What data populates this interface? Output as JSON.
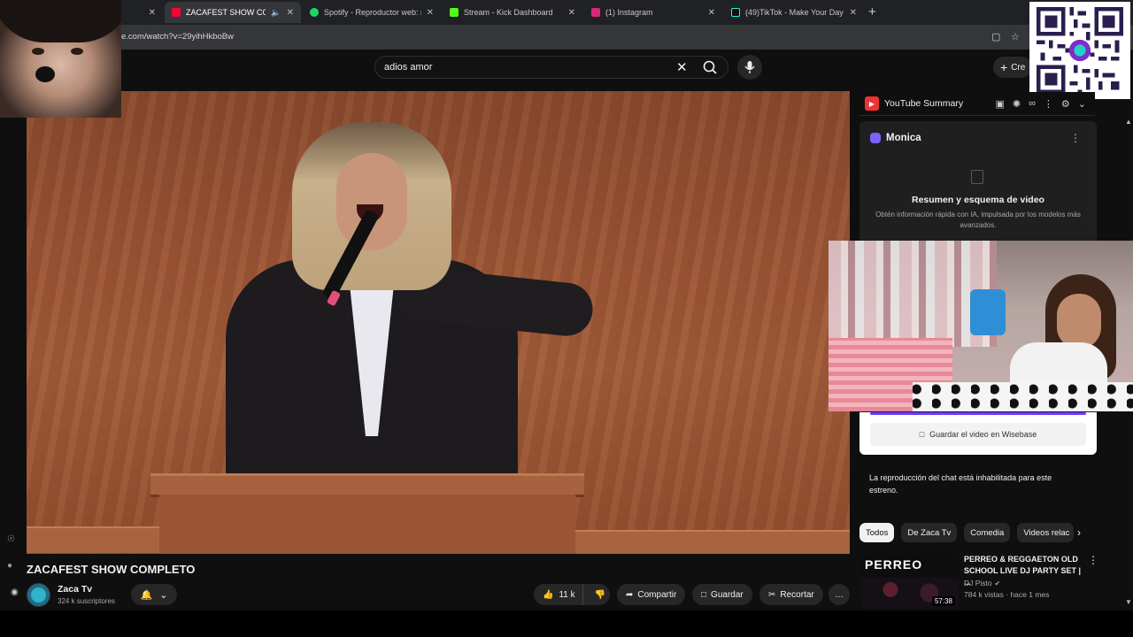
{
  "browser": {
    "tabs": [
      {
        "title": "",
        "active": false,
        "favicon_color": "#202124"
      },
      {
        "title": "ZACAFEST SHOW COMPLETO",
        "active": true,
        "favicon_color": "#ff0033",
        "muted_icon": "speaker-icon"
      },
      {
        "title": "Spotify - Reproductor web: música",
        "active": false,
        "favicon_color": "#1ed760"
      },
      {
        "title": "Stream - Kick Dashboard",
        "active": false,
        "favicon_color": "#53fc18"
      },
      {
        "title": "(1) Instagram",
        "active": false,
        "favicon_color": "#d62976"
      },
      {
        "title": "(49)TikTok - Make Your Day",
        "active": false,
        "favicon_color": "#111111"
      }
    ],
    "close_glyph": "✕",
    "new_tab_glyph": "+",
    "url": "e.com/watch?v=29yihHkboBw"
  },
  "search": {
    "value": "adios amor",
    "clear_glyph": "✕"
  },
  "header": {
    "create_label": "Cre"
  },
  "video": {
    "title": "ZACAFEST SHOW COMPLETO"
  },
  "channel": {
    "name": "Zaca Tv",
    "subscribers": "324 k suscriptores"
  },
  "actions": {
    "likes": "11 k",
    "share_label": "Compartir",
    "save_label": "Guardar",
    "clip_label": "Recortar",
    "more_glyph": "…"
  },
  "youtube_summary": {
    "title": "YouTube Summary"
  },
  "monica": {
    "name": "Monica",
    "card_title": "Resumen y esquema de video",
    "card_subtitle": "Obtén información rápida con IA, impulsada por los modelos más avanzados.",
    "wisebase_label": "Guardar el video en Wisebase"
  },
  "chat": {
    "disabled_text": "La reproducción del chat está inhabilitada para este estreno."
  },
  "chips": [
    "Todos",
    "De Zaca Tv",
    "Comedia",
    "Videos relac"
  ],
  "recommended": [
    {
      "thumb_text": "PERREO",
      "title": "PERREO & REGGAETON OLD SCHOOL LIVE DJ PARTY SET | ...",
      "channel": "DJ Pisto",
      "meta": "784 k vistas · hace 1 mes",
      "duration": "57:38"
    }
  ],
  "colors": {
    "background": "#0f0f0f",
    "accent_red": "#ff0033",
    "monica_purple": "#6b3cff"
  }
}
